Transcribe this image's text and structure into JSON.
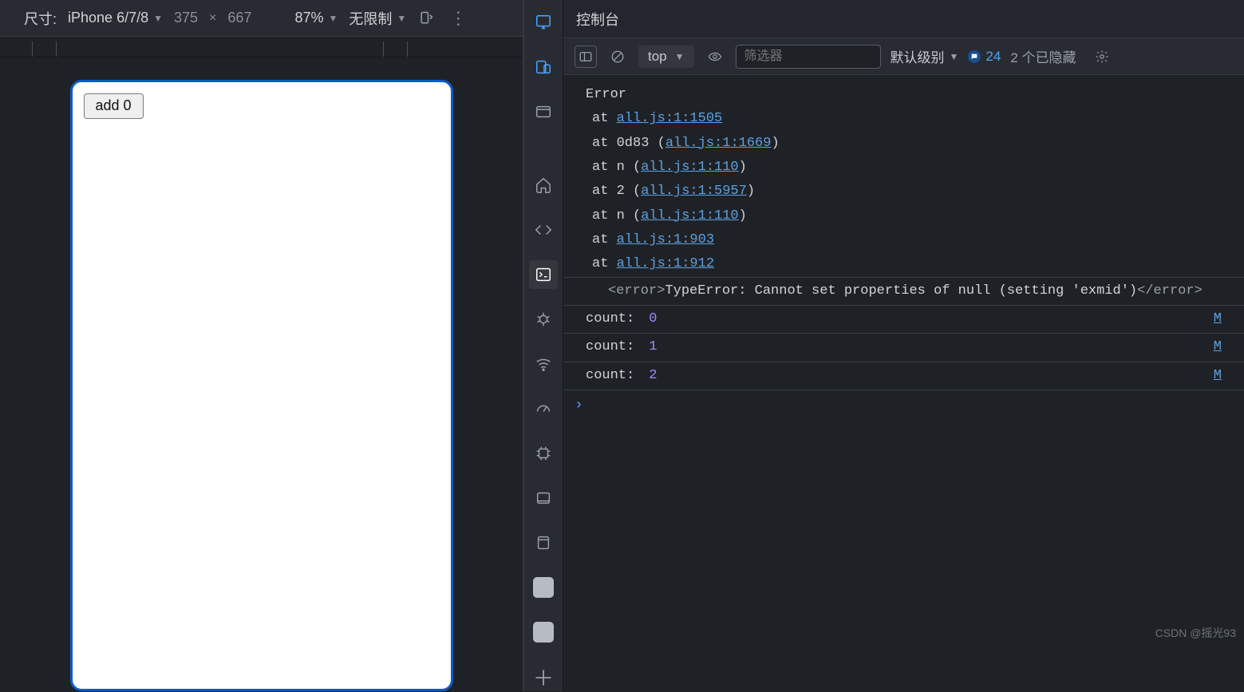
{
  "deviceBar": {
    "sizeLabel": "尺寸:",
    "deviceName": "iPhone 6/7/8",
    "width": "375",
    "dimSep": "×",
    "height": "667",
    "zoom": "87%",
    "throttle": "无限制"
  },
  "deviceContent": {
    "buttonLabel": "add 0"
  },
  "console": {
    "title": "控制台",
    "context": "top",
    "filterPlaceholder": "筛选器",
    "levelLabel": "默认级别",
    "messageCount": "24",
    "hiddenCount": "2 个已隐藏"
  },
  "error": {
    "header": "Error",
    "lines": [
      {
        "prefix": "at ",
        "mid": "",
        "link": "all.js:1:1505",
        "suffix": ""
      },
      {
        "prefix": "at 0d83 (",
        "mid": "",
        "link": "all.js:1:1669",
        "suffix": ")"
      },
      {
        "prefix": "at n (",
        "mid": "",
        "link": "all.js:1:110",
        "suffix": ")"
      },
      {
        "prefix": "at 2 (",
        "mid": "",
        "link": "all.js:1:5957",
        "suffix": ")"
      },
      {
        "prefix": "at n (",
        "mid": "",
        "link": "all.js:1:110",
        "suffix": ")"
      },
      {
        "prefix": "at ",
        "mid": "",
        "link": "all.js:1:903",
        "suffix": ""
      },
      {
        "prefix": "at ",
        "mid": "",
        "link": "all.js:1:912",
        "suffix": ""
      }
    ],
    "tagOpen": "<error>",
    "tagText": "TypeError: Cannot set properties of null (setting 'exmid')",
    "tagClose": "</error>"
  },
  "logs": [
    {
      "label": "count: ",
      "value": "0",
      "src": "M"
    },
    {
      "label": "count: ",
      "value": "1",
      "src": "M"
    },
    {
      "label": "count: ",
      "value": "2",
      "src": "M"
    }
  ],
  "prompt": "›",
  "watermark": "CSDN @摇光93"
}
